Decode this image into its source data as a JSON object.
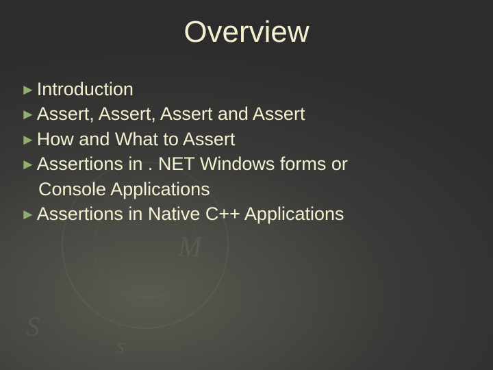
{
  "title": "Overview",
  "bullets": [
    {
      "text": "Introduction"
    },
    {
      "text": "Assert, Assert, Assert and Assert"
    },
    {
      "text": "How and What to Assert"
    },
    {
      "text": "Assertions in . NET Windows forms or",
      "continuation": "Console Applications"
    },
    {
      "text": "Assertions in Native C++ Applications"
    }
  ],
  "decor": {
    "m": "M",
    "s1": "S",
    "s2": "s"
  }
}
